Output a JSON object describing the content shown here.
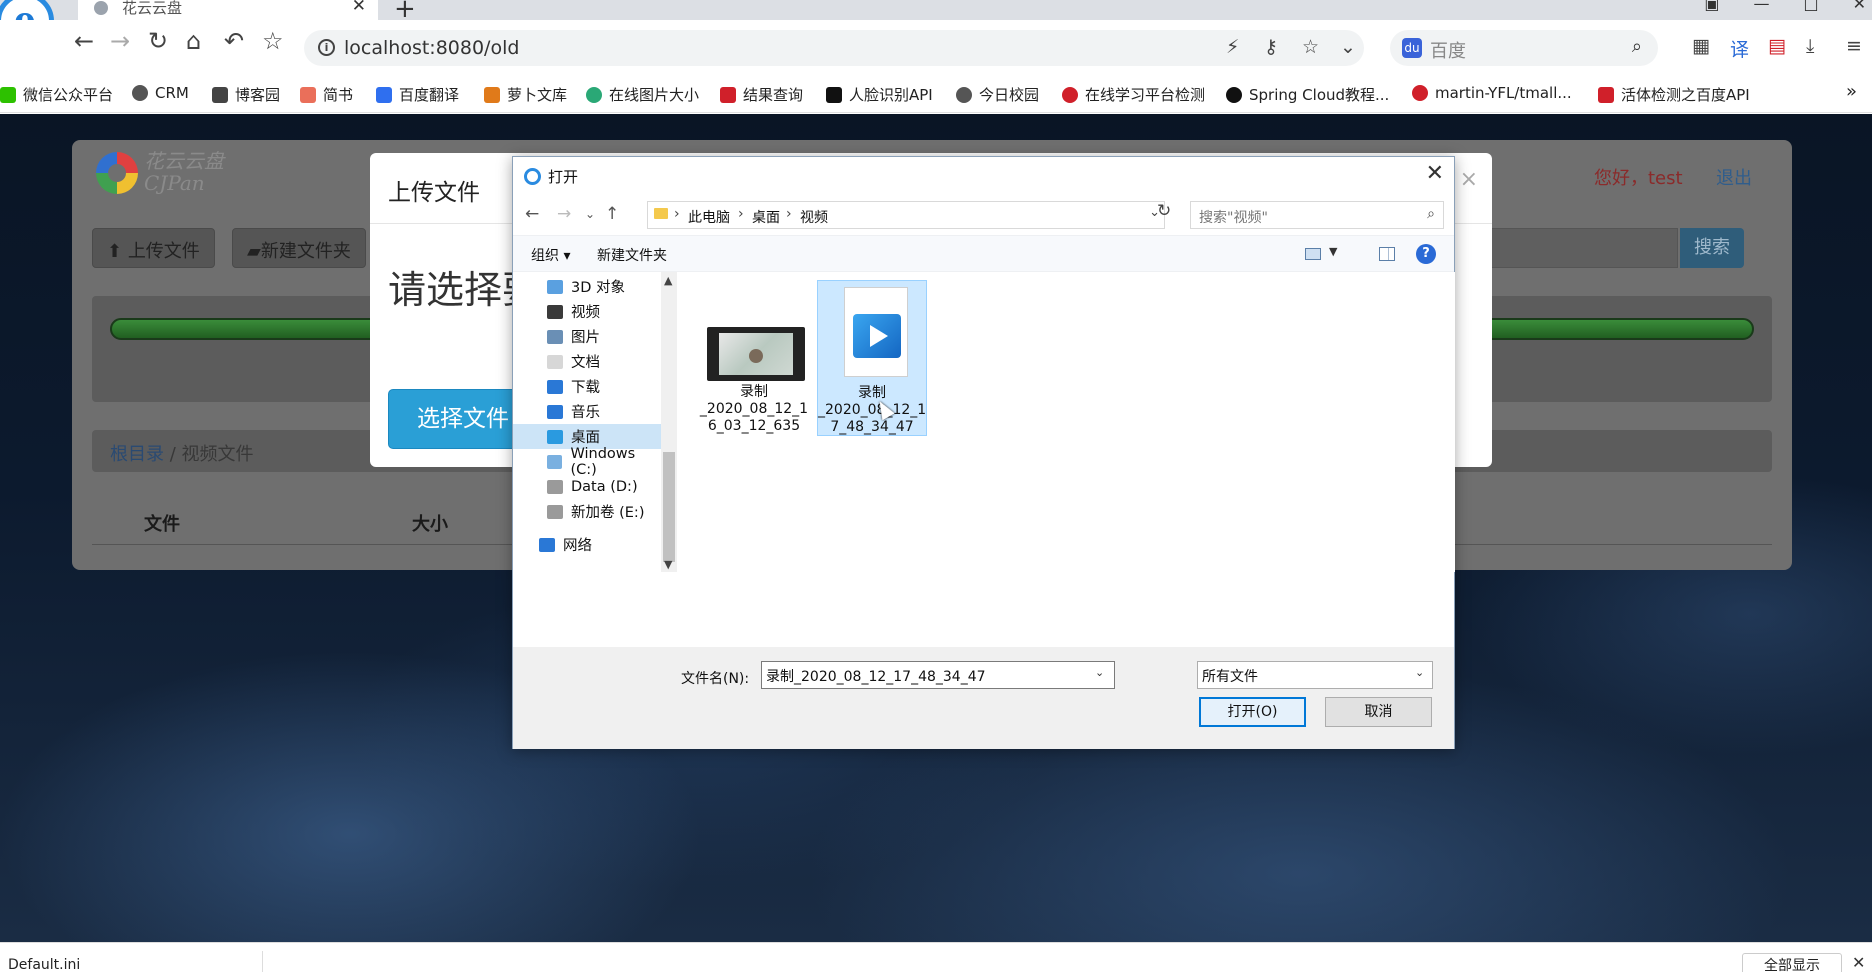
{
  "browser": {
    "tab_title": "花云云盘",
    "address": "localhost:8080/old",
    "search_placeholder": "百度"
  },
  "bookmarks": [
    {
      "label": "微信公众平台",
      "icon": "wechat-icon",
      "color": "#2dc100"
    },
    {
      "label": "CRM",
      "icon": "globe-icon",
      "color": "#555555"
    },
    {
      "label": "博客园",
      "icon": "cnblogs-icon",
      "color": "#444444"
    },
    {
      "label": "简书",
      "icon": "jianshu-icon",
      "color": "#ea6f5a"
    },
    {
      "label": "百度翻译",
      "icon": "translate-icon",
      "color": "#2f6fef"
    },
    {
      "label": "萝卜文库",
      "icon": "carrot-icon",
      "color": "#e07a1a"
    },
    {
      "label": "在线图片大小",
      "icon": "gear-icon",
      "color": "#2aa876"
    },
    {
      "label": "结果查询",
      "icon": "five-icon",
      "color": "#d0202a"
    },
    {
      "label": "人脸识别API",
      "icon": "ai-icon",
      "color": "#111111"
    },
    {
      "label": "今日校园",
      "icon": "globe-icon",
      "color": "#555555"
    },
    {
      "label": "在线学习平台检测",
      "icon": "g-icon",
      "color": "#d0202a"
    },
    {
      "label": "Spring Cloud教程...",
      "icon": "github-icon",
      "color": "#111111"
    },
    {
      "label": "martin-YFL/tmall...",
      "icon": "g-icon",
      "color": "#d0202a"
    },
    {
      "label": "活体检测之百度API",
      "icon": "c-icon",
      "color": "#d0202a"
    }
  ],
  "site": {
    "name_line1": "花云云盘",
    "name_line2": "CJPan",
    "greeting": "您好，test",
    "logout": "退出",
    "upload_btn": "上传文件",
    "new_folder_btn": "新建文件夹",
    "search_btn": "搜索",
    "breadcrumb_root": "根目录",
    "breadcrumb_current": "视频文件",
    "col_file": "文件",
    "col_size": "大小",
    "progress_fraction": 1.0
  },
  "upload_modal": {
    "title": "上传文件",
    "prompt": "请选择要",
    "choose_btn": "选择文件"
  },
  "dialog": {
    "title": "打开",
    "path": [
      "此电脑",
      "桌面",
      "视频"
    ],
    "search_placeholder": "搜索\"视频\"",
    "organize": "组织",
    "new_folder": "新建文件夹",
    "nav_items": [
      {
        "label": "3D 对象",
        "color": "#5aa0e0"
      },
      {
        "label": "视频",
        "color": "#3a3a3a"
      },
      {
        "label": "图片",
        "color": "#6a8fb5"
      },
      {
        "label": "文档",
        "color": "#d7d7d7"
      },
      {
        "label": "下载",
        "color": "#2a78d6"
      },
      {
        "label": "音乐",
        "color": "#2a78d6"
      },
      {
        "label": "桌面",
        "color": "#2a9ae0"
      },
      {
        "label": "Windows (C:)",
        "color": "#7ab0e0"
      },
      {
        "label": "Data (D:)",
        "color": "#9a9a9a"
      },
      {
        "label": "新加卷 (E:)",
        "color": "#9a9a9a"
      },
      {
        "label": "网络",
        "color": "#2a78d6"
      }
    ],
    "selected_nav": "桌面",
    "files": [
      {
        "name": [
          "录制",
          "_2020_08_12_1",
          "6_03_12_635"
        ],
        "kind": "video-thumbnail"
      },
      {
        "name": [
          "录制",
          "_2020_08_12_1",
          "7_48_34_47"
        ],
        "kind": "media-file"
      }
    ],
    "filename_label": "文件名(N):",
    "filename_value": "录制_2020_08_12_17_48_34_47",
    "filter_value": "所有文件",
    "open_btn": "打开(O)",
    "cancel_btn": "取消"
  },
  "download_bar": {
    "file": "Default.ini",
    "show_all": "全部显示"
  }
}
